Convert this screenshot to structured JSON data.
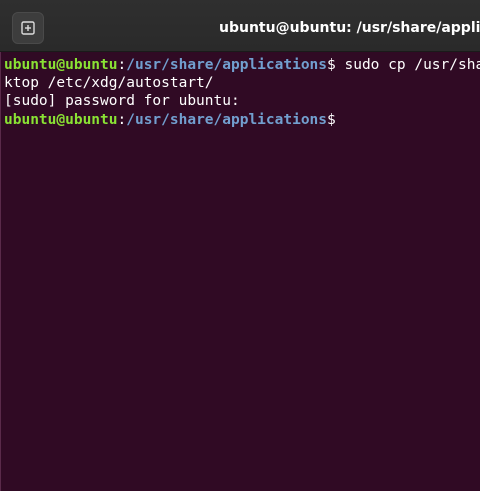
{
  "window": {
    "title": "ubuntu@ubuntu: /usr/share/applications"
  },
  "titlebar": {
    "new_tab_icon": "new-tab-icon"
  },
  "terminal": {
    "lines": [
      {
        "user_host": "ubuntu@ubuntu",
        "colon": ":",
        "path": "/usr/share/applications",
        "prompt_symbol": "$",
        "command": " sudo cp /usr/share/applications/"
      },
      {
        "text": "ktop /etc/xdg/autostart/"
      },
      {
        "text": "[sudo] password for ubuntu:"
      },
      {
        "user_host": "ubuntu@ubuntu",
        "colon": ":",
        "path": "/usr/share/applications",
        "prompt_symbol": "$",
        "command": ""
      }
    ]
  },
  "colors": {
    "background": "#300a24",
    "user_host": "#8ae234",
    "path": "#729fcf",
    "text": "#ffffff",
    "titlebar": "#2c2c2c"
  }
}
